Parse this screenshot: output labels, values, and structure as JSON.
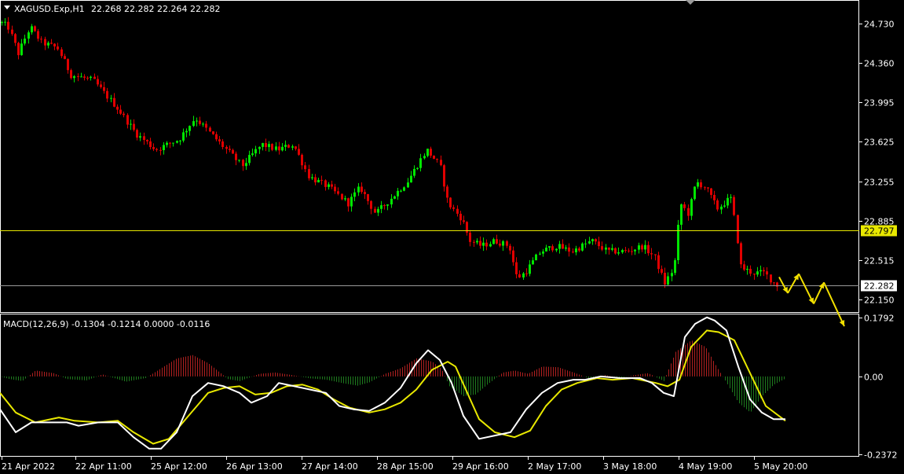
{
  "header": {
    "symbol": "XAGUSD.Exp,H1",
    "ohlc": "22.268 22.282 22.264 22.282"
  },
  "indicator": {
    "label": "MACD(12,26,9) -0.1304 -0.1214 0.0000 -0.0116"
  },
  "colors": {
    "background": "#000000",
    "frame": "#ffffff",
    "bull_candle": "#00e600",
    "bear_candle": "#e00000",
    "level_line": "#e8e800",
    "current_price_line": "#9a9a9a",
    "macd_line": "#ffffff",
    "signal_line": "#e8e800",
    "hist_positive": "#b02020",
    "hist_negative": "#1e7a1e",
    "forecast_arrow": "#f2e000"
  },
  "chart_data": [
    {
      "type": "candlestick",
      "title": "XAGUSD.Exp,H1",
      "ylim": [
        22.04,
        24.92
      ],
      "y_ticks": [
        "24.730",
        "24.360",
        "23.995",
        "23.625",
        "23.255",
        "22.885",
        "22.515",
        "22.150"
      ],
      "x_ticks": [
        "21 Apr 2022",
        "22 Apr 11:00",
        "25 Apr 12:00",
        "26 Apr 13:00",
        "27 Apr 14:00",
        "28 Apr 15:00",
        "29 Apr 16:00",
        "2 May 17:00",
        "3 May 18:00",
        "4 May 19:00",
        "5 May 20:00"
      ],
      "price_path": [
        [
          0,
          24.75
        ],
        [
          12,
          24.7
        ],
        [
          25,
          24.45
        ],
        [
          40,
          24.7
        ],
        [
          55,
          24.55
        ],
        [
          75,
          24.5
        ],
        [
          92,
          24.25
        ],
        [
          120,
          24.2
        ],
        [
          150,
          23.95
        ],
        [
          175,
          23.7
        ],
        [
          200,
          23.55
        ],
        [
          230,
          23.65
        ],
        [
          250,
          23.85
        ],
        [
          270,
          23.7
        ],
        [
          290,
          23.55
        ],
        [
          310,
          23.4
        ],
        [
          335,
          23.6
        ],
        [
          355,
          23.55
        ],
        [
          375,
          23.6
        ],
        [
          395,
          23.3
        ],
        [
          420,
          23.2
        ],
        [
          445,
          23.05
        ],
        [
          460,
          23.2
        ],
        [
          480,
          22.95
        ],
        [
          500,
          23.1
        ],
        [
          520,
          23.25
        ],
        [
          545,
          23.55
        ],
        [
          562,
          23.4
        ],
        [
          572,
          23.05
        ],
        [
          590,
          22.9
        ],
        [
          600,
          22.7
        ],
        [
          615,
          22.65
        ],
        [
          632,
          22.7
        ],
        [
          650,
          22.65
        ],
        [
          660,
          22.35
        ],
        [
          670,
          22.4
        ],
        [
          690,
          22.6
        ],
        [
          710,
          22.65
        ],
        [
          730,
          22.6
        ],
        [
          755,
          22.7
        ],
        [
          775,
          22.6
        ],
        [
          800,
          22.6
        ],
        [
          820,
          22.65
        ],
        [
          835,
          22.55
        ],
        [
          848,
          22.3
        ],
        [
          860,
          22.45
        ],
        [
          868,
          23.05
        ],
        [
          878,
          22.95
        ],
        [
          888,
          23.25
        ],
        [
          900,
          23.2
        ],
        [
          915,
          23.0
        ],
        [
          932,
          23.1
        ],
        [
          938,
          22.85
        ],
        [
          945,
          22.45
        ],
        [
          960,
          22.4
        ],
        [
          975,
          22.4
        ],
        [
          985,
          22.32
        ],
        [
          992,
          22.28
        ]
      ],
      "horizontal_levels": [
        {
          "label": "22.797",
          "value": 22.797,
          "kind": "level"
        },
        {
          "label": "22.282",
          "value": 22.282,
          "kind": "current"
        }
      ],
      "forecast_path": [
        [
          992,
          22.36
        ],
        [
          1003,
          22.21
        ],
        [
          1017,
          22.39
        ],
        [
          1036,
          22.11
        ],
        [
          1049,
          22.31
        ],
        [
          1075,
          21.9
        ]
      ]
    },
    {
      "type": "macd",
      "title": "MACD(12,26,9)",
      "ylim": [
        -0.2372,
        0.1792
      ],
      "y_ticks": [
        "0.1792",
        "0.00",
        "-0.2372"
      ],
      "macd_path": [
        [
          0,
          -0.1
        ],
        [
          20,
          -0.17
        ],
        [
          40,
          -0.14
        ],
        [
          65,
          -0.14
        ],
        [
          85,
          -0.14
        ],
        [
          100,
          -0.15
        ],
        [
          125,
          -0.14
        ],
        [
          150,
          -0.14
        ],
        [
          170,
          -0.185
        ],
        [
          190,
          -0.22
        ],
        [
          205,
          -0.22
        ],
        [
          225,
          -0.17
        ],
        [
          245,
          -0.06
        ],
        [
          265,
          -0.02
        ],
        [
          285,
          -0.03
        ],
        [
          305,
          -0.05
        ],
        [
          320,
          -0.08
        ],
        [
          340,
          -0.06
        ],
        [
          355,
          -0.02
        ],
        [
          375,
          -0.03
        ],
        [
          395,
          -0.04
        ],
        [
          415,
          -0.05
        ],
        [
          432,
          -0.09
        ],
        [
          450,
          -0.1
        ],
        [
          470,
          -0.105
        ],
        [
          490,
          -0.08
        ],
        [
          510,
          -0.035
        ],
        [
          530,
          0.04
        ],
        [
          545,
          0.08
        ],
        [
          560,
          0.05
        ],
        [
          575,
          -0.02
        ],
        [
          590,
          -0.12
        ],
        [
          610,
          -0.19
        ],
        [
          630,
          -0.18
        ],
        [
          650,
          -0.17
        ],
        [
          670,
          -0.1
        ],
        [
          690,
          -0.05
        ],
        [
          710,
          -0.02
        ],
        [
          730,
          -0.01
        ],
        [
          745,
          -0.01
        ],
        [
          765,
          0.0
        ],
        [
          790,
          -0.005
        ],
        [
          815,
          -0.005
        ],
        [
          830,
          -0.02
        ],
        [
          845,
          -0.05
        ],
        [
          858,
          -0.06
        ],
        [
          872,
          0.12
        ],
        [
          885,
          0.16
        ],
        [
          900,
          0.18
        ],
        [
          910,
          0.17
        ],
        [
          925,
          0.14
        ],
        [
          940,
          0.03
        ],
        [
          955,
          -0.07
        ],
        [
          970,
          -0.11
        ],
        [
          985,
          -0.13
        ],
        [
          1000,
          -0.13
        ]
      ],
      "signal_path": [
        [
          0,
          -0.05
        ],
        [
          20,
          -0.11
        ],
        [
          45,
          -0.14
        ],
        [
          75,
          -0.125
        ],
        [
          95,
          -0.135
        ],
        [
          125,
          -0.14
        ],
        [
          150,
          -0.135
        ],
        [
          170,
          -0.17
        ],
        [
          195,
          -0.205
        ],
        [
          215,
          -0.19
        ],
        [
          240,
          -0.12
        ],
        [
          265,
          -0.05
        ],
        [
          285,
          -0.035
        ],
        [
          305,
          -0.03
        ],
        [
          325,
          -0.055
        ],
        [
          345,
          -0.05
        ],
        [
          365,
          -0.03
        ],
        [
          385,
          -0.025
        ],
        [
          405,
          -0.04
        ],
        [
          425,
          -0.07
        ],
        [
          445,
          -0.095
        ],
        [
          470,
          -0.11
        ],
        [
          490,
          -0.1
        ],
        [
          510,
          -0.08
        ],
        [
          530,
          -0.04
        ],
        [
          550,
          0.02
        ],
        [
          570,
          0.045
        ],
        [
          580,
          0.03
        ],
        [
          595,
          -0.05
        ],
        [
          610,
          -0.13
        ],
        [
          630,
          -0.17
        ],
        [
          655,
          -0.185
        ],
        [
          675,
          -0.165
        ],
        [
          695,
          -0.09
        ],
        [
          715,
          -0.04
        ],
        [
          735,
          -0.02
        ],
        [
          760,
          -0.005
        ],
        [
          780,
          -0.01
        ],
        [
          805,
          -0.005
        ],
        [
          835,
          -0.02
        ],
        [
          850,
          -0.03
        ],
        [
          865,
          -0.01
        ],
        [
          880,
          0.09
        ],
        [
          900,
          0.14
        ],
        [
          915,
          0.135
        ],
        [
          935,
          0.11
        ],
        [
          955,
          0.01
        ],
        [
          975,
          -0.09
        ],
        [
          1000,
          -0.135
        ]
      ],
      "histogram_path": [
        [
          0,
          0.0
        ],
        [
          12,
          -0.008
        ],
        [
          28,
          -0.014
        ],
        [
          45,
          0.018
        ],
        [
          68,
          0.01
        ],
        [
          85,
          -0.008
        ],
        [
          110,
          -0.012
        ],
        [
          130,
          0.006
        ],
        [
          160,
          -0.016
        ],
        [
          185,
          -0.005
        ],
        [
          205,
          0.025
        ],
        [
          225,
          0.055
        ],
        [
          245,
          0.065
        ],
        [
          265,
          0.04
        ],
        [
          290,
          -0.008
        ],
        [
          305,
          -0.014
        ],
        [
          330,
          0.008
        ],
        [
          350,
          0.012
        ],
        [
          372,
          0.004
        ],
        [
          395,
          -0.006
        ],
        [
          415,
          -0.01
        ],
        [
          435,
          -0.02
        ],
        [
          455,
          -0.028
        ],
        [
          470,
          -0.018
        ],
        [
          490,
          0.008
        ],
        [
          510,
          0.025
        ],
        [
          530,
          0.055
        ],
        [
          550,
          0.045
        ],
        [
          562,
          0.022
        ],
        [
          572,
          -0.03
        ],
        [
          590,
          -0.06
        ],
        [
          605,
          -0.055
        ],
        [
          620,
          -0.025
        ],
        [
          640,
          0.012
        ],
        [
          655,
          0.018
        ],
        [
          672,
          0.008
        ],
        [
          690,
          0.03
        ],
        [
          710,
          0.028
        ],
        [
          730,
          0.012
        ],
        [
          750,
          -0.006
        ],
        [
          770,
          0.004
        ],
        [
          790,
          -0.004
        ],
        [
          810,
          0.005
        ],
        [
          825,
          0.01
        ],
        [
          845,
          -0.014
        ],
        [
          860,
          0.075
        ],
        [
          880,
          0.11
        ],
        [
          898,
          0.09
        ],
        [
          912,
          0.03
        ],
        [
          925,
          -0.02
        ],
        [
          940,
          -0.08
        ],
        [
          955,
          -0.11
        ],
        [
          970,
          -0.06
        ],
        [
          985,
          -0.025
        ],
        [
          1000,
          -0.006
        ]
      ]
    }
  ]
}
